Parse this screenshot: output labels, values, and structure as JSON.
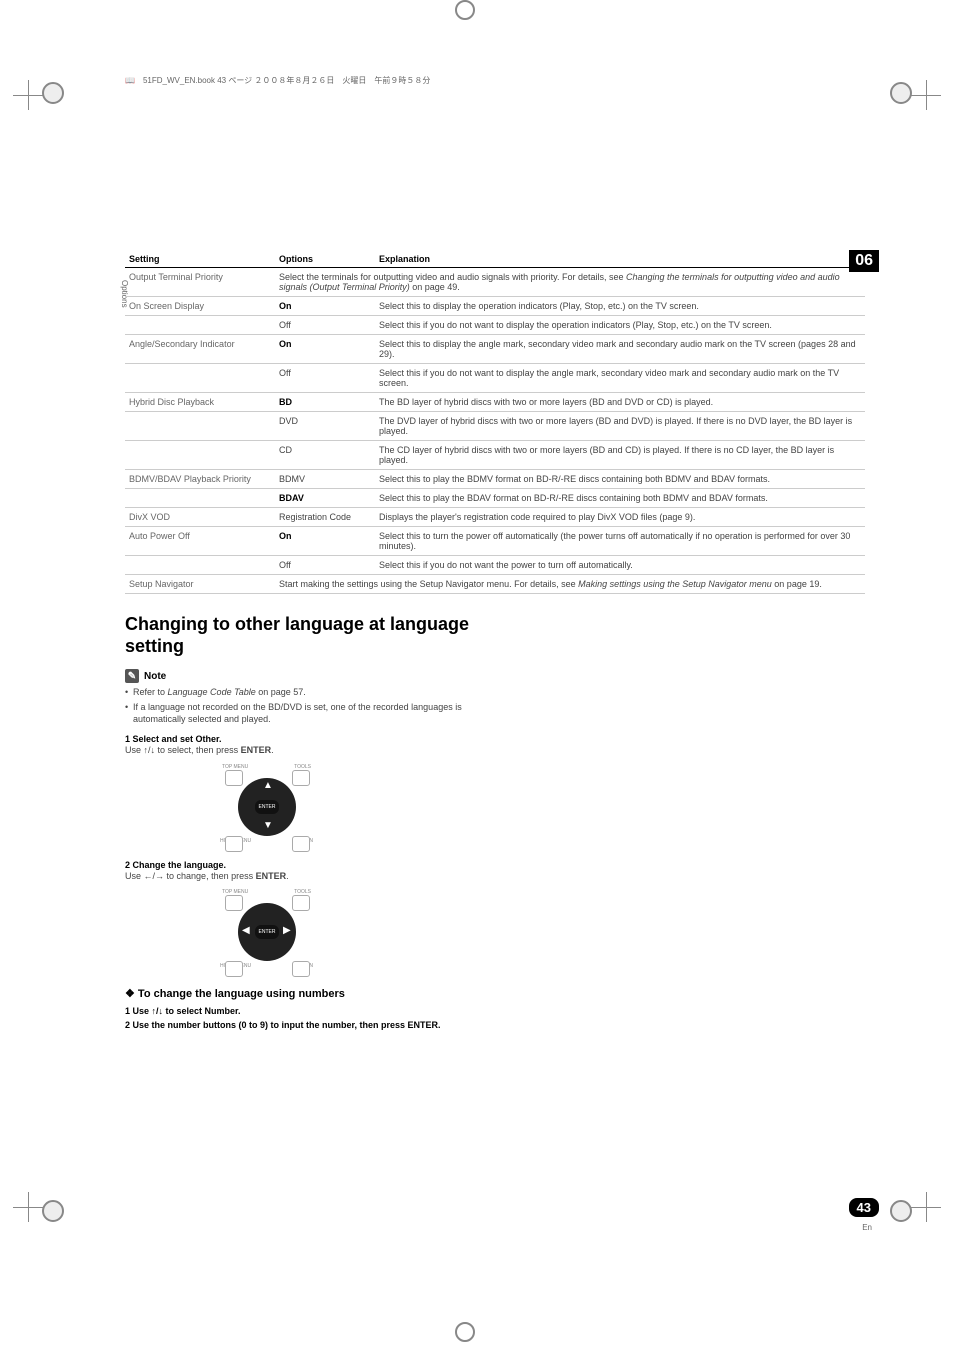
{
  "header_note": "51FD_WV_EN.book  43 ページ  ２００８年８月２６日　火曜日　午前９時５８分",
  "chapter_number": "06",
  "page_number": "43",
  "lang_code": "En",
  "side_label": "Options",
  "table": {
    "headers": [
      "Setting",
      "Options",
      "Explanation"
    ],
    "rows": [
      {
        "setting": "Output Terminal Priority",
        "option": "",
        "explanation_prefix": "Select the terminals for outputting video and audio signals with priority. For details, see ",
        "explanation_italic": "Changing the terminals for outputting video and audio signals (Output Terminal Priority)",
        "explanation_suffix": " on page 49.",
        "colspan": true
      },
      {
        "setting": "On Screen Display",
        "option": "On",
        "option_bold": true,
        "explanation": "Select this to display the operation indicators (Play, Stop, etc.) on the TV screen."
      },
      {
        "setting": "",
        "option": "Off",
        "explanation": "Select this if you do not want to display the operation indicators (Play, Stop, etc.) on the TV screen."
      },
      {
        "setting": "Angle/Secondary Indicator",
        "option": "On",
        "option_bold": true,
        "explanation": "Select this to display the angle mark, secondary video mark and secondary audio mark on the TV screen (pages 28 and 29)."
      },
      {
        "setting": "",
        "option": "Off",
        "explanation": "Select this if you do not want to display the angle mark, secondary video mark and secondary audio mark on the TV screen."
      },
      {
        "setting": "Hybrid Disc Playback",
        "option": "BD",
        "option_bold": true,
        "explanation": "The BD layer of hybrid discs with two or more layers (BD and DVD or CD) is played."
      },
      {
        "setting": "",
        "option": "DVD",
        "explanation": "The DVD layer of hybrid discs with two or more layers (BD and DVD) is played. If there is no DVD layer, the BD layer is played."
      },
      {
        "setting": "",
        "option": "CD",
        "explanation": "The CD layer of hybrid discs with two or more layers (BD and CD) is played. If there is no CD layer, the BD layer is played."
      },
      {
        "setting": "BDMV/BDAV Playback Priority",
        "option": "BDMV",
        "explanation": "Select this to play the BDMV format on BD-R/-RE discs containing both BDMV and BDAV formats."
      },
      {
        "setting": "",
        "option": "BDAV",
        "option_bold": true,
        "explanation": "Select this to play the BDAV format on BD-R/-RE discs containing both BDMV and BDAV formats."
      },
      {
        "setting": "DivX VOD",
        "option": "Registration Code",
        "explanation": "Displays the player's registration code required to play DivX VOD files (page 9)."
      },
      {
        "setting": "Auto Power Off",
        "option": "On",
        "option_bold": true,
        "explanation": "Select this to turn the power off automatically (the power turns off automatically if no operation is performed for over 30 minutes)."
      },
      {
        "setting": "",
        "option": "Off",
        "explanation": "Select this if you do not want the power to turn off automatically."
      },
      {
        "setting": "Setup Navigator",
        "option": "",
        "explanation_prefix": "Start making the settings using the Setup Navigator menu. For details, see ",
        "explanation_italic": "Making settings using the Setup Navigator menu",
        "explanation_suffix": " on page 19.",
        "colspan": true
      }
    ]
  },
  "section_heading": "Changing to other language at language setting",
  "note_label": "Note",
  "bullets": [
    {
      "prefix": "Refer to ",
      "italic": "Language Code Table",
      "suffix": " on page 57."
    },
    {
      "text": "If a language not recorded on the BD/DVD is set, one of the recorded languages is automatically selected and played."
    }
  ],
  "step1_heading": "1   Select and set Other.",
  "step1_text_prefix": "Use ",
  "step1_arrows": "↑/↓",
  "step1_text_mid": " to select, then press ",
  "step1_enter": "ENTER",
  "step1_text_suffix": ".",
  "step2_heading": "2   Change the language.",
  "step2_text_prefix": "Use ",
  "step2_arrows": "←/→",
  "step2_text_mid": " to change, then press ",
  "step2_enter": "ENTER",
  "step2_text_suffix": ".",
  "sub_heading": "❖ To change the language using numbers",
  "sub_step1": "1   Use ↑/↓ to select Number.",
  "sub_step2": "2   Use the number buttons (0 to 9) to input the number, then press ENTER.",
  "remote": {
    "top_menu": "TOP MENU",
    "tools": "TOOLS",
    "home_menu": "HOME MENU",
    "return": "RETURN",
    "enter": "ENTER"
  }
}
